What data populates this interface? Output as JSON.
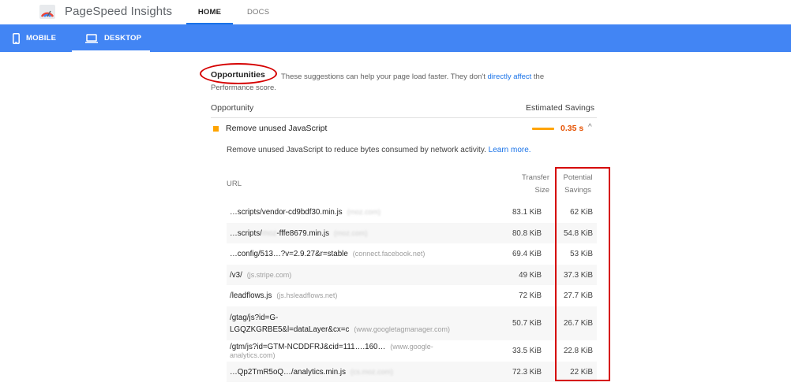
{
  "header": {
    "app_title": "PageSpeed Insights",
    "tabs": [
      {
        "label": "HOME",
        "active": true
      },
      {
        "label": "DOCS",
        "active": false
      }
    ]
  },
  "device_bar": {
    "color": "#4285f4",
    "tabs": [
      {
        "label": "MOBILE",
        "icon": "phone-icon",
        "active": false
      },
      {
        "label": "DESKTOP",
        "icon": "laptop-icon",
        "active": true
      }
    ]
  },
  "opportunities": {
    "heading": "Opportunities",
    "desc_prefix": "These suggestions can help your page load faster. They don't",
    "desc_link": "directly affect",
    "desc_suffix": "the",
    "desc_line2": "Performance score.",
    "col_left": "Opportunity",
    "col_right": "Estimated Savings"
  },
  "audit": {
    "title": "Remove unused JavaScript",
    "savings": "0.35 s",
    "status_color": "#ffa400",
    "description": "Remove unused JavaScript to reduce bytes consumed by network activity.",
    "learn_more": "Learn more.",
    "table_headers": {
      "url": "URL",
      "transfer_size_1": "Transfer",
      "transfer_size_2": "Size",
      "potential_1": "Potential",
      "potential_2": "Savings"
    },
    "rows": [
      {
        "url": "…scripts/vendor-cd9bdf30.min.js",
        "host": "(moz.com)",
        "host_blurred": true,
        "size": "83.1 KiB",
        "savings": "62 KiB"
      },
      {
        "url_pre": "…scripts/",
        "url_blur": "moz",
        "url_post": "-fffe8679.min.js",
        "host": "(moz.com)",
        "host_blurred": true,
        "size": "80.8 KiB",
        "savings": "54.8 KiB"
      },
      {
        "url": "…config/513…?v=2.9.27&r=stable",
        "host": "(connect.facebook.net)",
        "host_blurred": false,
        "size": "69.4 KiB",
        "savings": "53 KiB"
      },
      {
        "url": "/v3/",
        "host": "(js.stripe.com)",
        "host_blurred": false,
        "size": "49 KiB",
        "savings": "37.3 KiB"
      },
      {
        "url": "/leadflows.js",
        "host": "(js.hsleadflows.net)",
        "host_blurred": false,
        "size": "72 KiB",
        "savings": "27.7 KiB"
      },
      {
        "url_line1": "/gtag/js?id=G-",
        "url_line2": "LGQZKGRBE5&l=dataLayer&cx=c",
        "host": "(www.googletagmanager.com)",
        "host_blurred": false,
        "size": "50.7 KiB",
        "savings": "26.7 KiB"
      },
      {
        "url": "/gtm/js?id=GTM-NCDDFRJ&cid=111….160…",
        "host": "(www.google-analytics.com)",
        "host_blurred": false,
        "size": "33.5 KiB",
        "savings": "22.8 KiB"
      },
      {
        "url": "…Qp2TmR5oQ…/analytics.min.js",
        "host": "(cs.moz.com)",
        "host_blurred": true,
        "size": "72.3 KiB",
        "savings": "22 KiB"
      }
    ]
  }
}
